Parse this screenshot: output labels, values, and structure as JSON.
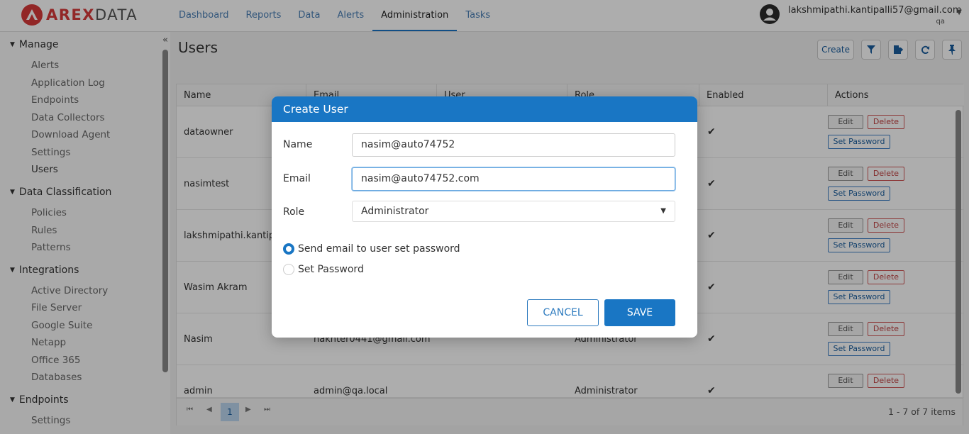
{
  "brand": {
    "name_part1": "AREX",
    "name_part2": "DATA",
    "accent": "#d73a3a"
  },
  "nav": [
    {
      "label": "Dashboard"
    },
    {
      "label": "Reports"
    },
    {
      "label": "Data"
    },
    {
      "label": "Alerts"
    },
    {
      "label": "Administration",
      "active": true
    },
    {
      "label": "Tasks"
    }
  ],
  "user": {
    "email": "lakshmipathi.kantipalli57@gmail.com",
    "role": "qa",
    "icon": "account-circle-icon"
  },
  "sidebar": {
    "collapse_glyph": "«",
    "sections": [
      {
        "title": "Manage",
        "items": [
          "Alerts",
          "Application Log",
          "Endpoints",
          "Data Collectors",
          "Download Agent",
          "Settings",
          "Users"
        ]
      },
      {
        "title": "Data Classification",
        "items": [
          "Policies",
          "Rules",
          "Patterns"
        ]
      },
      {
        "title": "Integrations",
        "items": [
          "Active Directory",
          "File Server",
          "Google Suite",
          "Netapp",
          "Office 365",
          "Databases"
        ]
      },
      {
        "title": "Endpoints",
        "items": [
          "Settings"
        ]
      }
    ],
    "active_item": "Users"
  },
  "page": {
    "title": "Users",
    "toolbar": {
      "create_label": "Create",
      "icons": [
        "filter-icon",
        "export-icon",
        "refresh-icon",
        "pin-icon"
      ]
    }
  },
  "table": {
    "columns": [
      "Name",
      "Email",
      "User",
      "Role",
      "Enabled",
      "Actions"
    ],
    "rows": [
      {
        "name": "dataowner",
        "email": "",
        "role": "",
        "enabled": "✔"
      },
      {
        "name": "nasimtest",
        "email": "",
        "role": "",
        "enabled": "✔"
      },
      {
        "name": "lakshmipathi.kantipa",
        "email": "",
        "role": "",
        "enabled": "✔"
      },
      {
        "name": "Wasim Akram",
        "email": "",
        "role": "",
        "enabled": "✔"
      },
      {
        "name": "Nasim",
        "email": "nakhter0441@gmail.com",
        "role": "Administrator",
        "enabled": "✔"
      },
      {
        "name": "admin",
        "email": "admin@qa.local",
        "role": "Administrator",
        "enabled": "✔"
      }
    ],
    "actions": {
      "edit": "Edit",
      "delete": "Delete",
      "set_password": "Set Password"
    },
    "pager": {
      "first": "⏮",
      "prev": "◀",
      "page": "1",
      "next": "▶",
      "last": "⏭",
      "info": "1 - 7 of 7 items"
    }
  },
  "modal": {
    "title": "Create User",
    "name_label": "Name",
    "name_value": "nasim@auto74752",
    "email_label": "Email",
    "email_value": "nasim@auto74752.com",
    "role_label": "Role",
    "role_value": "Administrator",
    "radio_email": "Send email to user set password",
    "radio_password": "Set Password",
    "selected_radio": "radio_email",
    "cancel_label": "CANCEL",
    "save_label": "SAVE",
    "accent": "#1976c4"
  }
}
